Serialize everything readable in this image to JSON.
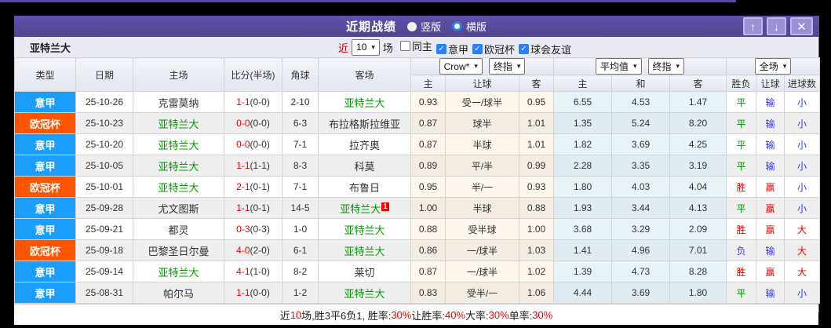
{
  "titlebar": {
    "title": "近期战绩",
    "radios": [
      {
        "label": "竖版",
        "selected": false
      },
      {
        "label": "横版",
        "selected": true
      }
    ],
    "window_buttons": {
      "up": "↑",
      "down": "↓",
      "close": "✕"
    }
  },
  "filter": {
    "team": "亚特兰大",
    "near_label": "近",
    "count": "10",
    "unit": "场",
    "checkboxes": [
      {
        "label": "同主",
        "checked": false
      },
      {
        "label": "意甲",
        "checked": true
      },
      {
        "label": "欧冠杯",
        "checked": true
      },
      {
        "label": "球会友谊",
        "checked": true
      }
    ]
  },
  "colors": {
    "accent_purple": "#564a9e",
    "serie_a_blue": "#1c9eff",
    "ucl_orange": "#ff5400",
    "win_red": "#f00000",
    "draw_green": "#009900",
    "lose_blue": "#3333ff",
    "self_team_green": "#009900"
  },
  "table": {
    "left_headers": [
      "类型",
      "日期",
      "主场",
      "比分(半场)",
      "角球",
      "客场"
    ],
    "dropdowns": [
      {
        "label": "Crow*"
      },
      {
        "label": "终指"
      },
      {
        "label": "平均值"
      },
      {
        "label": "终指"
      },
      {
        "label": "全场"
      }
    ],
    "sub_headers": [
      "主",
      "让球",
      "客",
      "主",
      "和",
      "客",
      "胜负",
      "让球",
      "进球数"
    ],
    "rows": [
      {
        "type": {
          "label": "意甲",
          "bg": "#1c9eff"
        },
        "date": "25-10-26",
        "home": {
          "name": "克雷莫纳",
          "self": false
        },
        "score": "1-1",
        "half": "(0-0)",
        "corner": "2-10",
        "away": {
          "name": "亚特兰大",
          "self": true
        },
        "h_home": "0.93",
        "handicap": "受一/球半",
        "h_away": "0.95",
        "o_home": "6.55",
        "o_draw": "4.53",
        "o_away": "1.47",
        "res_wdl": {
          "text": "平",
          "color": "#009900"
        },
        "res_handicap": {
          "text": "输",
          "color": "#3333ff"
        },
        "res_goals": {
          "text": "小",
          "color": "#3333ff"
        }
      },
      {
        "type": {
          "label": "欧冠杯",
          "bg": "#ff5400"
        },
        "date": "25-10-23",
        "home": {
          "name": "亚特兰大",
          "self": true
        },
        "score": "0-0",
        "half": "(0-0)",
        "corner": "6-3",
        "away": {
          "name": "布拉格斯拉维亚",
          "self": false
        },
        "h_home": "0.87",
        "handicap": "球半",
        "h_away": "1.01",
        "o_home": "1.35",
        "o_draw": "5.24",
        "o_away": "8.20",
        "res_wdl": {
          "text": "平",
          "color": "#009900"
        },
        "res_handicap": {
          "text": "输",
          "color": "#3333ff"
        },
        "res_goals": {
          "text": "小",
          "color": "#3333ff"
        }
      },
      {
        "type": {
          "label": "意甲",
          "bg": "#1c9eff"
        },
        "date": "25-10-20",
        "home": {
          "name": "亚特兰大",
          "self": true
        },
        "score": "0-0",
        "half": "(0-0)",
        "corner": "7-1",
        "away": {
          "name": "拉齐奥",
          "self": false
        },
        "h_home": "0.87",
        "handicap": "半球",
        "h_away": "1.01",
        "o_home": "1.82",
        "o_draw": "3.69",
        "o_away": "4.25",
        "res_wdl": {
          "text": "平",
          "color": "#009900"
        },
        "res_handicap": {
          "text": "输",
          "color": "#3333ff"
        },
        "res_goals": {
          "text": "小",
          "color": "#3333ff"
        }
      },
      {
        "type": {
          "label": "意甲",
          "bg": "#1c9eff"
        },
        "date": "25-10-05",
        "home": {
          "name": "亚特兰大",
          "self": true
        },
        "score": "1-1",
        "half": "(1-1)",
        "corner": "8-3",
        "away": {
          "name": "科莫",
          "self": false
        },
        "h_home": "0.89",
        "handicap": "平/半",
        "h_away": "0.99",
        "o_home": "2.28",
        "o_draw": "3.35",
        "o_away": "3.19",
        "res_wdl": {
          "text": "平",
          "color": "#009900"
        },
        "res_handicap": {
          "text": "输",
          "color": "#3333ff"
        },
        "res_goals": {
          "text": "小",
          "color": "#3333ff"
        }
      },
      {
        "type": {
          "label": "欧冠杯",
          "bg": "#ff5400"
        },
        "date": "25-10-01",
        "home": {
          "name": "亚特兰大",
          "self": true
        },
        "score": "2-1",
        "half": "(0-1)",
        "corner": "7-1",
        "away": {
          "name": "布鲁日",
          "self": false
        },
        "h_home": "0.95",
        "handicap": "半/一",
        "h_away": "0.93",
        "o_home": "1.80",
        "o_draw": "4.03",
        "o_away": "4.04",
        "res_wdl": {
          "text": "胜",
          "color": "#f00000"
        },
        "res_handicap": {
          "text": "赢",
          "color": "#f00000"
        },
        "res_goals": {
          "text": "小",
          "color": "#3333ff"
        }
      },
      {
        "type": {
          "label": "意甲",
          "bg": "#1c9eff"
        },
        "date": "25-09-28",
        "home": {
          "name": "尤文图斯",
          "self": false
        },
        "score": "1-1",
        "half": "(0-1)",
        "corner": "14-5",
        "away": {
          "name": "亚特兰大",
          "self": true,
          "badge": "1"
        },
        "h_home": "1.00",
        "handicap": "半球",
        "h_away": "0.88",
        "o_home": "1.93",
        "o_draw": "3.44",
        "o_away": "4.13",
        "res_wdl": {
          "text": "平",
          "color": "#009900"
        },
        "res_handicap": {
          "text": "赢",
          "color": "#f00000"
        },
        "res_goals": {
          "text": "小",
          "color": "#3333ff"
        }
      },
      {
        "type": {
          "label": "意甲",
          "bg": "#1c9eff"
        },
        "date": "25-09-21",
        "home": {
          "name": "都灵",
          "self": false
        },
        "score": "0-3",
        "half": "(0-3)",
        "corner": "1-0",
        "away": {
          "name": "亚特兰大",
          "self": true
        },
        "h_home": "0.88",
        "handicap": "受半球",
        "h_away": "1.00",
        "o_home": "3.68",
        "o_draw": "3.29",
        "o_away": "2.09",
        "res_wdl": {
          "text": "胜",
          "color": "#f00000"
        },
        "res_handicap": {
          "text": "赢",
          "color": "#f00000"
        },
        "res_goals": {
          "text": "大",
          "color": "#f00000"
        }
      },
      {
        "type": {
          "label": "欧冠杯",
          "bg": "#ff5400"
        },
        "date": "25-09-18",
        "home": {
          "name": "巴黎圣日尔曼",
          "self": false
        },
        "score": "4-0",
        "half": "(2-0)",
        "corner": "6-1",
        "away": {
          "name": "亚特兰大",
          "self": true
        },
        "h_home": "0.86",
        "handicap": "一/球半",
        "h_away": "1.03",
        "o_home": "1.41",
        "o_draw": "4.96",
        "o_away": "7.01",
        "res_wdl": {
          "text": "负",
          "color": "#3333ff"
        },
        "res_handicap": {
          "text": "输",
          "color": "#3333ff"
        },
        "res_goals": {
          "text": "大",
          "color": "#f00000"
        }
      },
      {
        "type": {
          "label": "意甲",
          "bg": "#1c9eff"
        },
        "date": "25-09-14",
        "home": {
          "name": "亚特兰大",
          "self": true
        },
        "score": "4-1",
        "half": "(1-0)",
        "corner": "8-2",
        "away": {
          "name": "莱切",
          "self": false
        },
        "h_home": "0.87",
        "handicap": "一/球半",
        "h_away": "1.02",
        "o_home": "1.39",
        "o_draw": "4.73",
        "o_away": "8.28",
        "res_wdl": {
          "text": "胜",
          "color": "#f00000"
        },
        "res_handicap": {
          "text": "赢",
          "color": "#f00000"
        },
        "res_goals": {
          "text": "大",
          "color": "#f00000"
        }
      },
      {
        "type": {
          "label": "意甲",
          "bg": "#1c9eff"
        },
        "date": "25-08-31",
        "home": {
          "name": "帕尔马",
          "self": false
        },
        "score": "1-1",
        "half": "(0-0)",
        "corner": "1-2",
        "away": {
          "name": "亚特兰大",
          "self": true
        },
        "h_home": "0.83",
        "handicap": "受半/一",
        "h_away": "1.06",
        "o_home": "4.44",
        "o_draw": "3.69",
        "o_away": "1.80",
        "res_wdl": {
          "text": "平",
          "color": "#009900"
        },
        "res_handicap": {
          "text": "输",
          "color": "#3333ff"
        },
        "res_goals": {
          "text": "小",
          "color": "#3333ff"
        }
      }
    ]
  },
  "footer": {
    "segments": [
      {
        "text": "近",
        "red": false
      },
      {
        "text": "10",
        "red": true
      },
      {
        "text": "场,胜3平6负1, 胜率:",
        "red": false
      },
      {
        "text": "30%",
        "red": true
      },
      {
        "text": " 让胜率:",
        "red": false
      },
      {
        "text": "40%",
        "red": true
      },
      {
        "text": " 大率:",
        "red": false
      },
      {
        "text": "30%",
        "red": true
      },
      {
        "text": " 单率:",
        "red": false
      },
      {
        "text": "30%",
        "red": true
      }
    ]
  }
}
